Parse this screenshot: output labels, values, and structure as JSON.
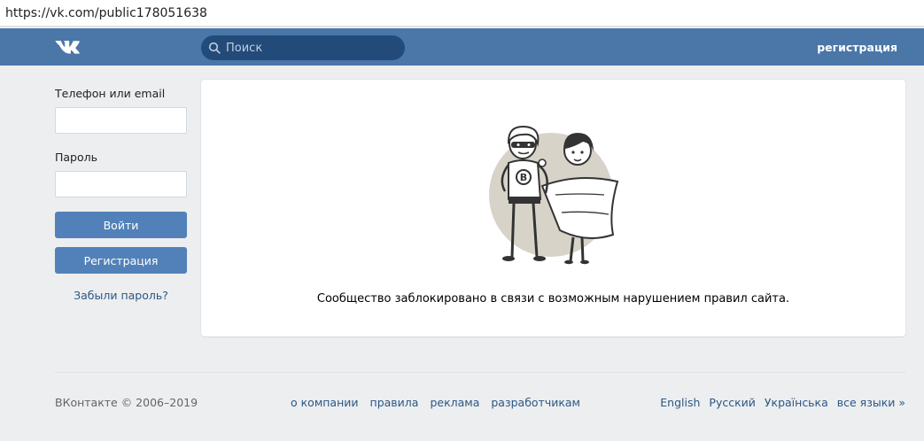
{
  "browser": {
    "url": "https://vk.com/public178051638"
  },
  "header": {
    "logo_icon": "vk-logo",
    "search_placeholder": "Поиск",
    "register_link": "регистрация",
    "bg_color": "#4a76a8"
  },
  "login": {
    "phone_label": "Телефон или email",
    "phone_value": "",
    "password_label": "Пароль",
    "password_value": "",
    "login_button": "Войти",
    "register_button": "Регистрация",
    "forgot_link": "Забыли пароль?"
  },
  "main": {
    "illustration_icon": "superhero-couple-illustration",
    "message": "Сообщество заблокировано в связи с возможным нарушением правил сайта."
  },
  "footer": {
    "copyright": "ВКонтакте © 2006–2019",
    "links": [
      "о компании",
      "правила",
      "реклама",
      "разработчикам"
    ],
    "languages": [
      "English",
      "Русский",
      "Українська",
      "все языки »"
    ]
  }
}
